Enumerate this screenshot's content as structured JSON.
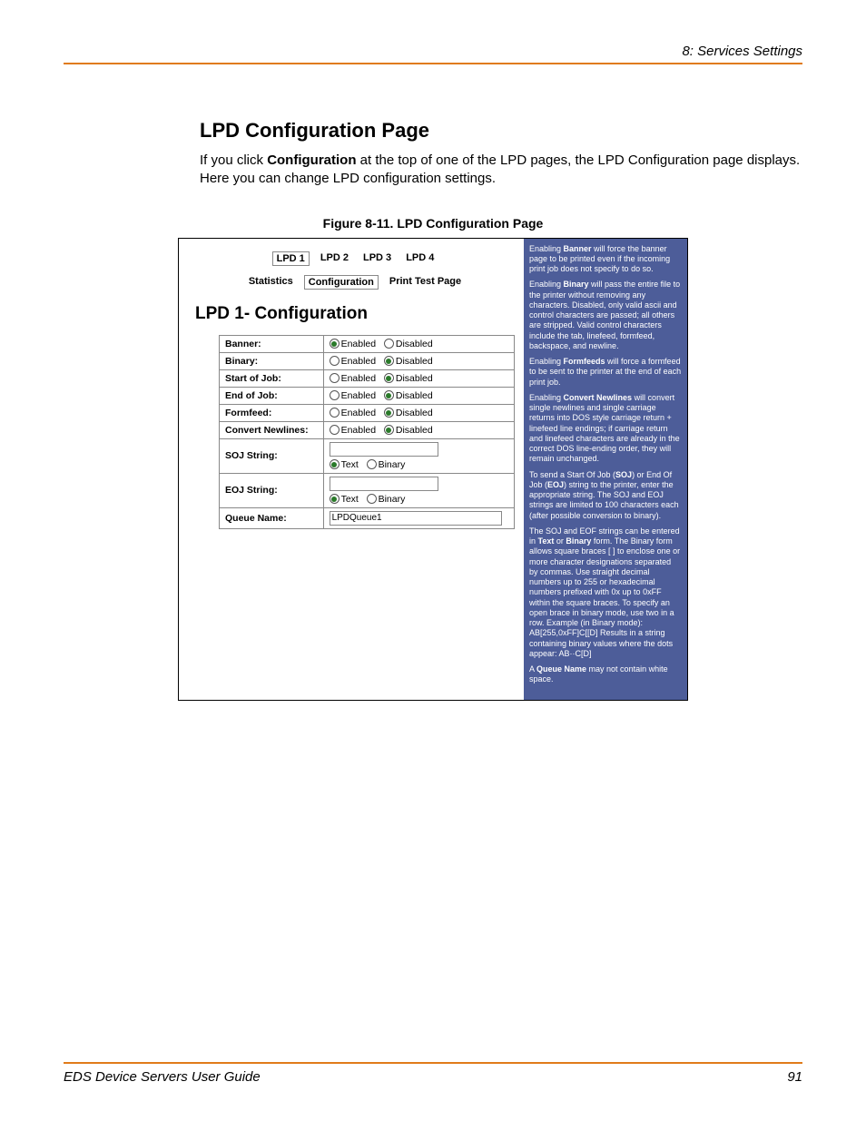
{
  "header": {
    "chapter": "8: Services Settings"
  },
  "section": {
    "title": "LPD Configuration Page",
    "intro_a": "If you click ",
    "intro_bold": "Configuration",
    "intro_b": " at the top of one of the LPD pages, the LPD Configuration page displays. Here you can change LPD configuration settings."
  },
  "figure": {
    "caption": "Figure 8-11. LPD Configuration Page"
  },
  "ui": {
    "tabs": [
      "LPD 1",
      "LPD 2",
      "LPD 3",
      "LPD 4"
    ],
    "selected_tab": 0,
    "subtabs": [
      "Statistics",
      "Configuration",
      "Print Test Page"
    ],
    "selected_subtab": 1,
    "heading": "LPD 1- Configuration",
    "rows": {
      "banner": {
        "label": "Banner:",
        "enabled": "Enabled",
        "disabled": "Disabled",
        "sel": "enabled"
      },
      "binary": {
        "label": "Binary:",
        "enabled": "Enabled",
        "disabled": "Disabled",
        "sel": "disabled"
      },
      "soj": {
        "label": "Start of Job:",
        "enabled": "Enabled",
        "disabled": "Disabled",
        "sel": "disabled"
      },
      "eoj": {
        "label": "End of Job:",
        "enabled": "Enabled",
        "disabled": "Disabled",
        "sel": "disabled"
      },
      "formfeed": {
        "label": "Formfeed:",
        "enabled": "Enabled",
        "disabled": "Disabled",
        "sel": "disabled"
      },
      "convert": {
        "label": "Convert Newlines:",
        "enabled": "Enabled",
        "disabled": "Disabled",
        "sel": "disabled"
      },
      "sojstr": {
        "label": "SOJ String:",
        "text": "Text",
        "binary": "Binary",
        "sel": "text",
        "value": ""
      },
      "eojstr": {
        "label": "EOJ String:",
        "text": "Text",
        "binary": "Binary",
        "sel": "text",
        "value": ""
      },
      "queue": {
        "label": "Queue Name:",
        "value": "LPDQueue1"
      }
    },
    "help": {
      "p1a": "Enabling ",
      "p1b": "Banner",
      "p1c": " will force the banner page to be printed even if the incoming print job does not specify to do so.",
      "p2a": "Enabling ",
      "p2b": "Binary",
      "p2c": " will pass the entire file to the printer without removing any characters. Disabled, only valid ascii and control characters are passed; all others are stripped. Valid control characters include the tab, linefeed, formfeed, backspace, and newline.",
      "p3a": "Enabling ",
      "p3b": "Formfeeds",
      "p3c": " will force a formfeed to be sent to the printer at the end of each print job.",
      "p4a": "Enabling ",
      "p4b": "Convert Newlines",
      "p4c": " will convert single newlines and single carriage returns into DOS style carriage return + linefeed line endings; if carriage return and linefeed characters are already in the correct DOS line-ending order, they will remain unchanged.",
      "p5a": "To send a Start Of Job (",
      "p5b": "SOJ",
      "p5c": ") or End Of Job (",
      "p5d": "EOJ",
      "p5e": ") string to the printer, enter the appropriate string. The SOJ and EOJ strings are limited to 100 characters each (after possible conversion to binary).",
      "p6a": "The SOJ and EOF strings can be entered in ",
      "p6b": "Text",
      "p6c": " or ",
      "p6d": "Binary",
      "p6e": " form. The Binary form allows square braces [ ] to enclose one or more character designations separated by commas. Use straight decimal numbers up to 255 or hexadecimal numbers prefixed with 0x up to 0xFF within the square braces. To specify an open brace in binary mode, use two in a row. Example (in Binary mode): AB[255,0xFF]C[[D] Results in a string containing binary values where the dots appear: AB··C[D]",
      "p7a": "A ",
      "p7b": "Queue Name",
      "p7c": " may not contain white space."
    }
  },
  "footer": {
    "guide": "EDS Device Servers User Guide",
    "page": "91"
  }
}
